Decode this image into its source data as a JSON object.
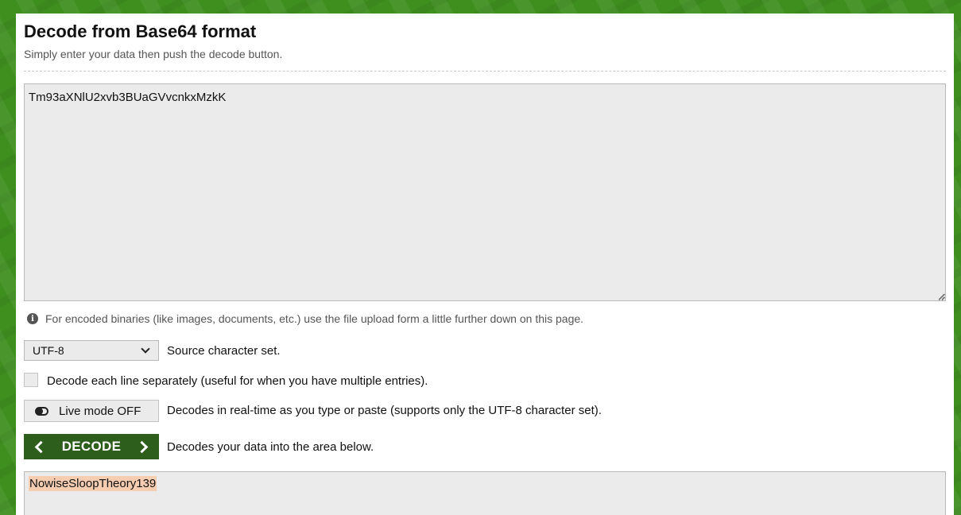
{
  "header": {
    "title": "Decode from Base64 format",
    "subtitle": "Simply enter your data then push the decode button."
  },
  "input": {
    "value": "Tm93aXNlU2xvb3BUaGVvcnkxMzkK"
  },
  "info": {
    "icon": "info-icon",
    "text": "For encoded binaries (like images, documents, etc.) use the file upload form a little further down on this page."
  },
  "charset": {
    "selected": "UTF-8",
    "label": "Source character set."
  },
  "line_option": {
    "checked": false,
    "label": "Decode each line separately (useful for when you have multiple entries)."
  },
  "live_mode": {
    "button_label": "Live mode OFF",
    "icon": "toggle-off-icon",
    "description": "Decodes in real-time as you type or paste (supports only the UTF-8 character set)."
  },
  "decode": {
    "button_label": "DECODE",
    "description": "Decodes your data into the area below."
  },
  "output": {
    "value": "NowiseSloopTheory139"
  },
  "colors": {
    "background_green": "#3f8f1f",
    "button_dark_green": "#2d5e1c",
    "field_gray": "#ebebeb",
    "selection_highlight": "#f6cdb0"
  }
}
